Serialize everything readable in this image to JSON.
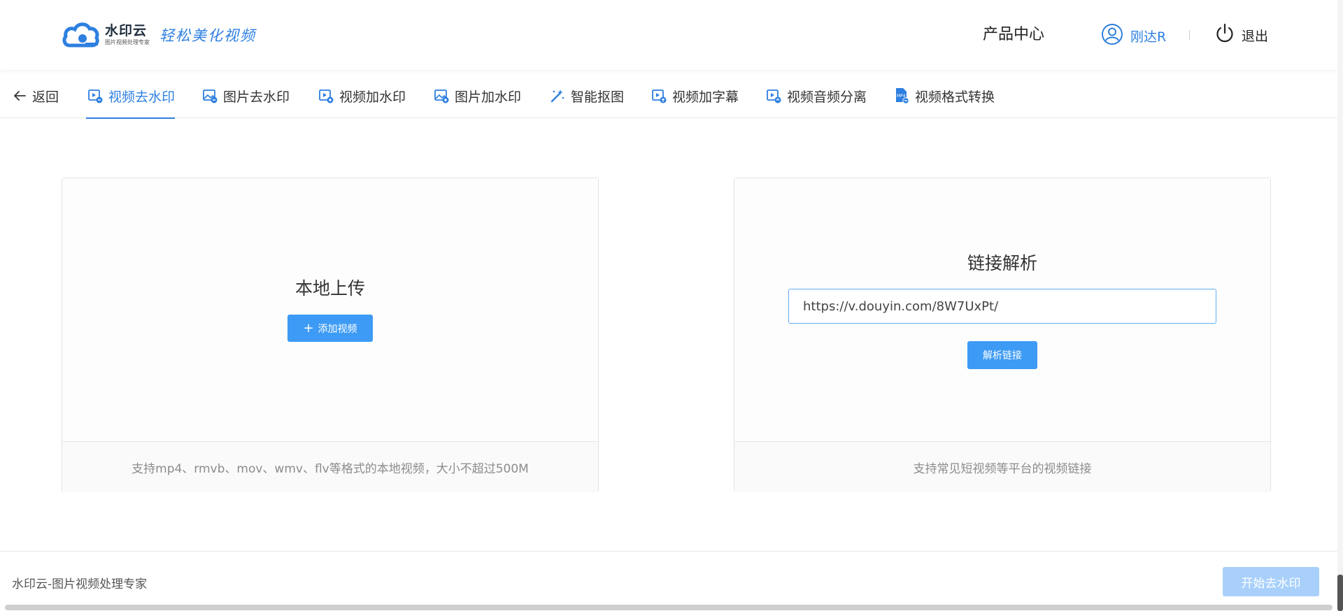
{
  "header": {
    "logo_name": "水印云",
    "logo_sub": "图片视频处理专家",
    "logo_slogan": "轻松美化视频",
    "product_center": "产品中心",
    "user_name": "刚达R",
    "logout_label": "退出"
  },
  "tabs": [
    {
      "label": "返回",
      "icon": "arrow-left-icon"
    },
    {
      "label": "视频去水印",
      "icon": "video-remove-watermark-icon",
      "active": true
    },
    {
      "label": "图片去水印",
      "icon": "image-remove-watermark-icon"
    },
    {
      "label": "视频加水印",
      "icon": "video-add-watermark-icon"
    },
    {
      "label": "图片加水印",
      "icon": "image-add-watermark-icon"
    },
    {
      "label": "智能抠图",
      "icon": "magic-wand-icon"
    },
    {
      "label": "视频加字幕",
      "icon": "video-subtitle-icon"
    },
    {
      "label": "视频音频分离",
      "icon": "video-audio-split-icon"
    },
    {
      "label": "视频格式转换",
      "icon": "mp4-convert-icon"
    }
  ],
  "local_upload": {
    "title": "本地上传",
    "button_label": "添加视频",
    "hint": "支持mp4、rmvb、mov、wmv、flv等格式的本地视频，大小不超过500M"
  },
  "link_parse": {
    "title": "链接解析",
    "input_value": "https://v.douyin.com/8W7UxPt/",
    "button_label": "解析链接",
    "hint": "支持常见短视频等平台的视频链接"
  },
  "footer": {
    "text": "水印云-图片视频处理专家",
    "start_button": "开始去水印"
  },
  "colors": {
    "accent": "#2d7fe0",
    "button": "#3d9bf5",
    "button_disabled": "#a8d0fb"
  }
}
